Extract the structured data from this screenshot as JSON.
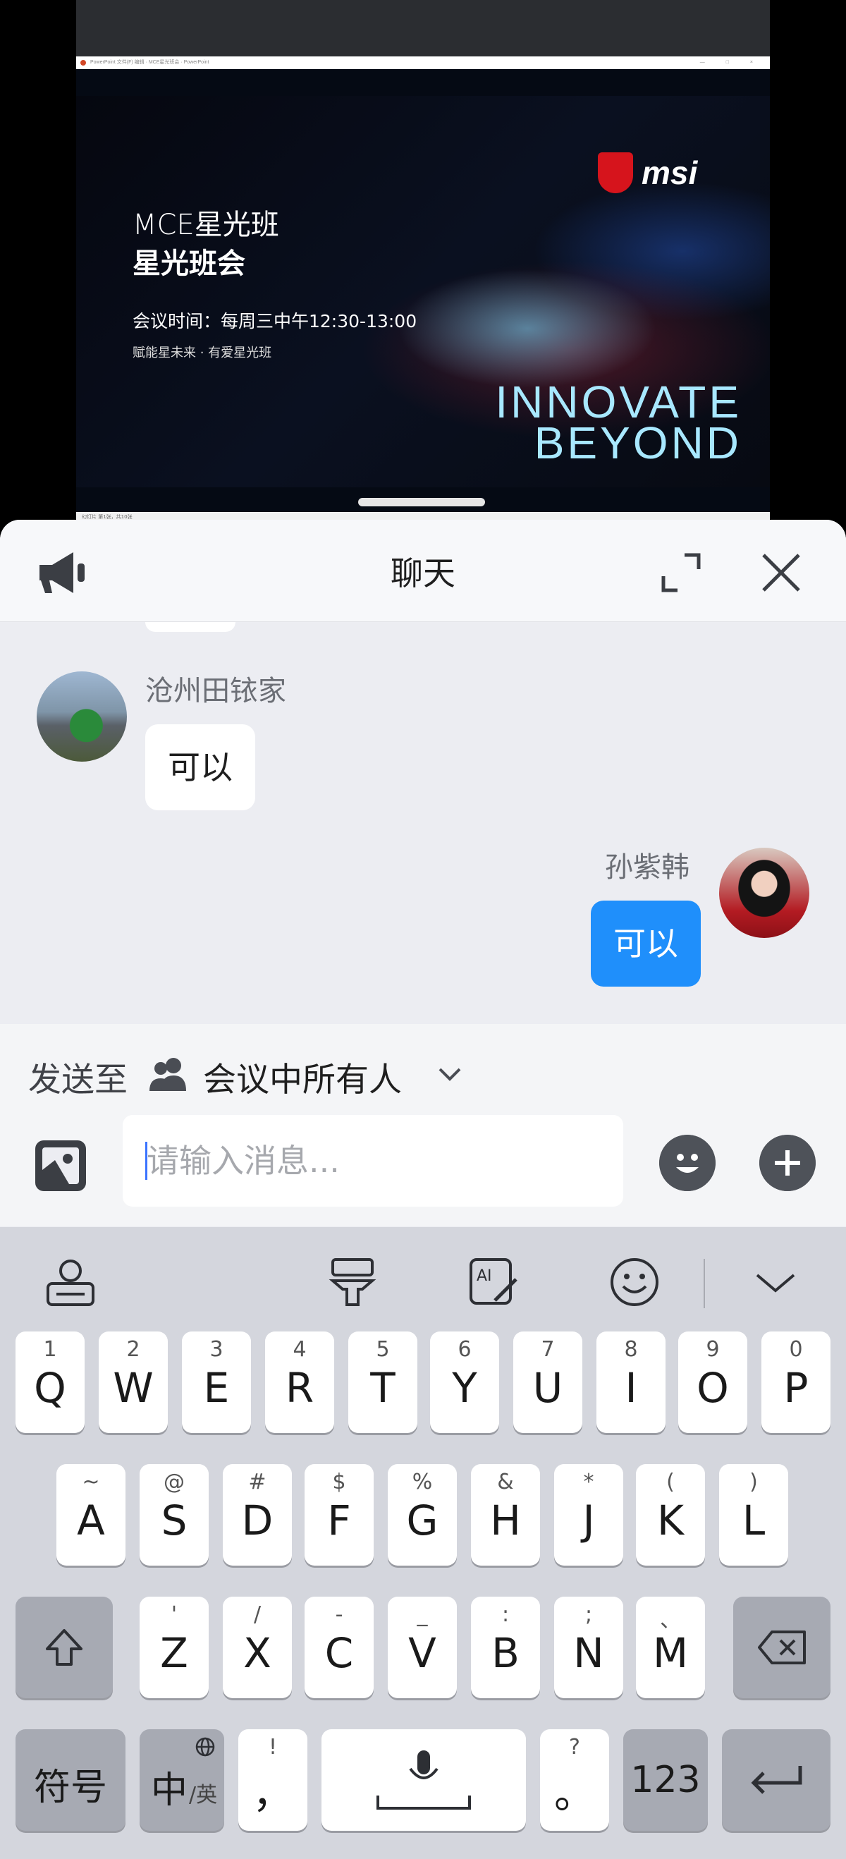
{
  "shared_screen": {
    "window_title": "PowerPoint 文件(F) 编辑 · MCE星光班会 · PowerPoint",
    "window_buttons": "— □ ×",
    "status_bar": "幻灯片 第1张，共10张",
    "slide": {
      "title_line1": "MCE星光班",
      "title_line2": "星光班会",
      "meeting_time": "会议时间：每周三中午12:30-13:00",
      "tagline": "赋能星未来 · 有爱星光班",
      "brand": "msi",
      "slogan_line1": "INNOVATE",
      "slogan_line2": "BEYOND"
    }
  },
  "chat": {
    "header": {
      "title": "聊天",
      "left_icon": "megaphone-icon",
      "expand_icon": "expand-icon",
      "close_icon": "close-icon"
    },
    "messages": [
      {
        "sender": "沧州田铱家",
        "text": "可以",
        "side": "left"
      },
      {
        "sender": "孙紫韩",
        "text": "可以",
        "side": "right"
      }
    ],
    "send_to": {
      "label": "发送至",
      "value": "会议中所有人"
    },
    "composer": {
      "placeholder": "请输入消息..."
    }
  },
  "keyboard": {
    "toolbar": [
      "keyboard-globe-icon",
      "brush-icon",
      "ai-write-icon",
      "emoji-icon",
      "collapse-chevron-icon"
    ],
    "row1": [
      {
        "hint": "1",
        "key": "Q"
      },
      {
        "hint": "2",
        "key": "W"
      },
      {
        "hint": "3",
        "key": "E"
      },
      {
        "hint": "4",
        "key": "R"
      },
      {
        "hint": "5",
        "key": "T"
      },
      {
        "hint": "6",
        "key": "Y"
      },
      {
        "hint": "7",
        "key": "U"
      },
      {
        "hint": "8",
        "key": "I"
      },
      {
        "hint": "9",
        "key": "O"
      },
      {
        "hint": "0",
        "key": "P"
      }
    ],
    "row2": [
      {
        "hint": "~",
        "key": "A"
      },
      {
        "hint": "@",
        "key": "S"
      },
      {
        "hint": "#",
        "key": "D"
      },
      {
        "hint": "$",
        "key": "F"
      },
      {
        "hint": "%",
        "key": "G"
      },
      {
        "hint": "&",
        "key": "H"
      },
      {
        "hint": "*",
        "key": "J"
      },
      {
        "hint": "(",
        "key": "K"
      },
      {
        "hint": ")",
        "key": "L"
      }
    ],
    "row3": [
      {
        "hint": "'",
        "key": "Z"
      },
      {
        "hint": "/",
        "key": "X"
      },
      {
        "hint": "-",
        "key": "C"
      },
      {
        "hint": "_",
        "key": "V"
      },
      {
        "hint": ":",
        "key": "B"
      },
      {
        "hint": ";",
        "key": "N"
      },
      {
        "hint": "、",
        "key": "M"
      }
    ],
    "symbols_label": "符号",
    "lang_main": "中",
    "lang_sub": "/英",
    "comma_hint": "!",
    "comma_key": "，",
    "period_hint": "?",
    "period_key": "。",
    "num_label": "123",
    "colors": {
      "background": "#d4d6dd",
      "key": "#ffffff",
      "key_dark": "#a7aab3"
    }
  },
  "colors": {
    "accent": "#1f8ffb",
    "panel": "#ecedf2"
  }
}
